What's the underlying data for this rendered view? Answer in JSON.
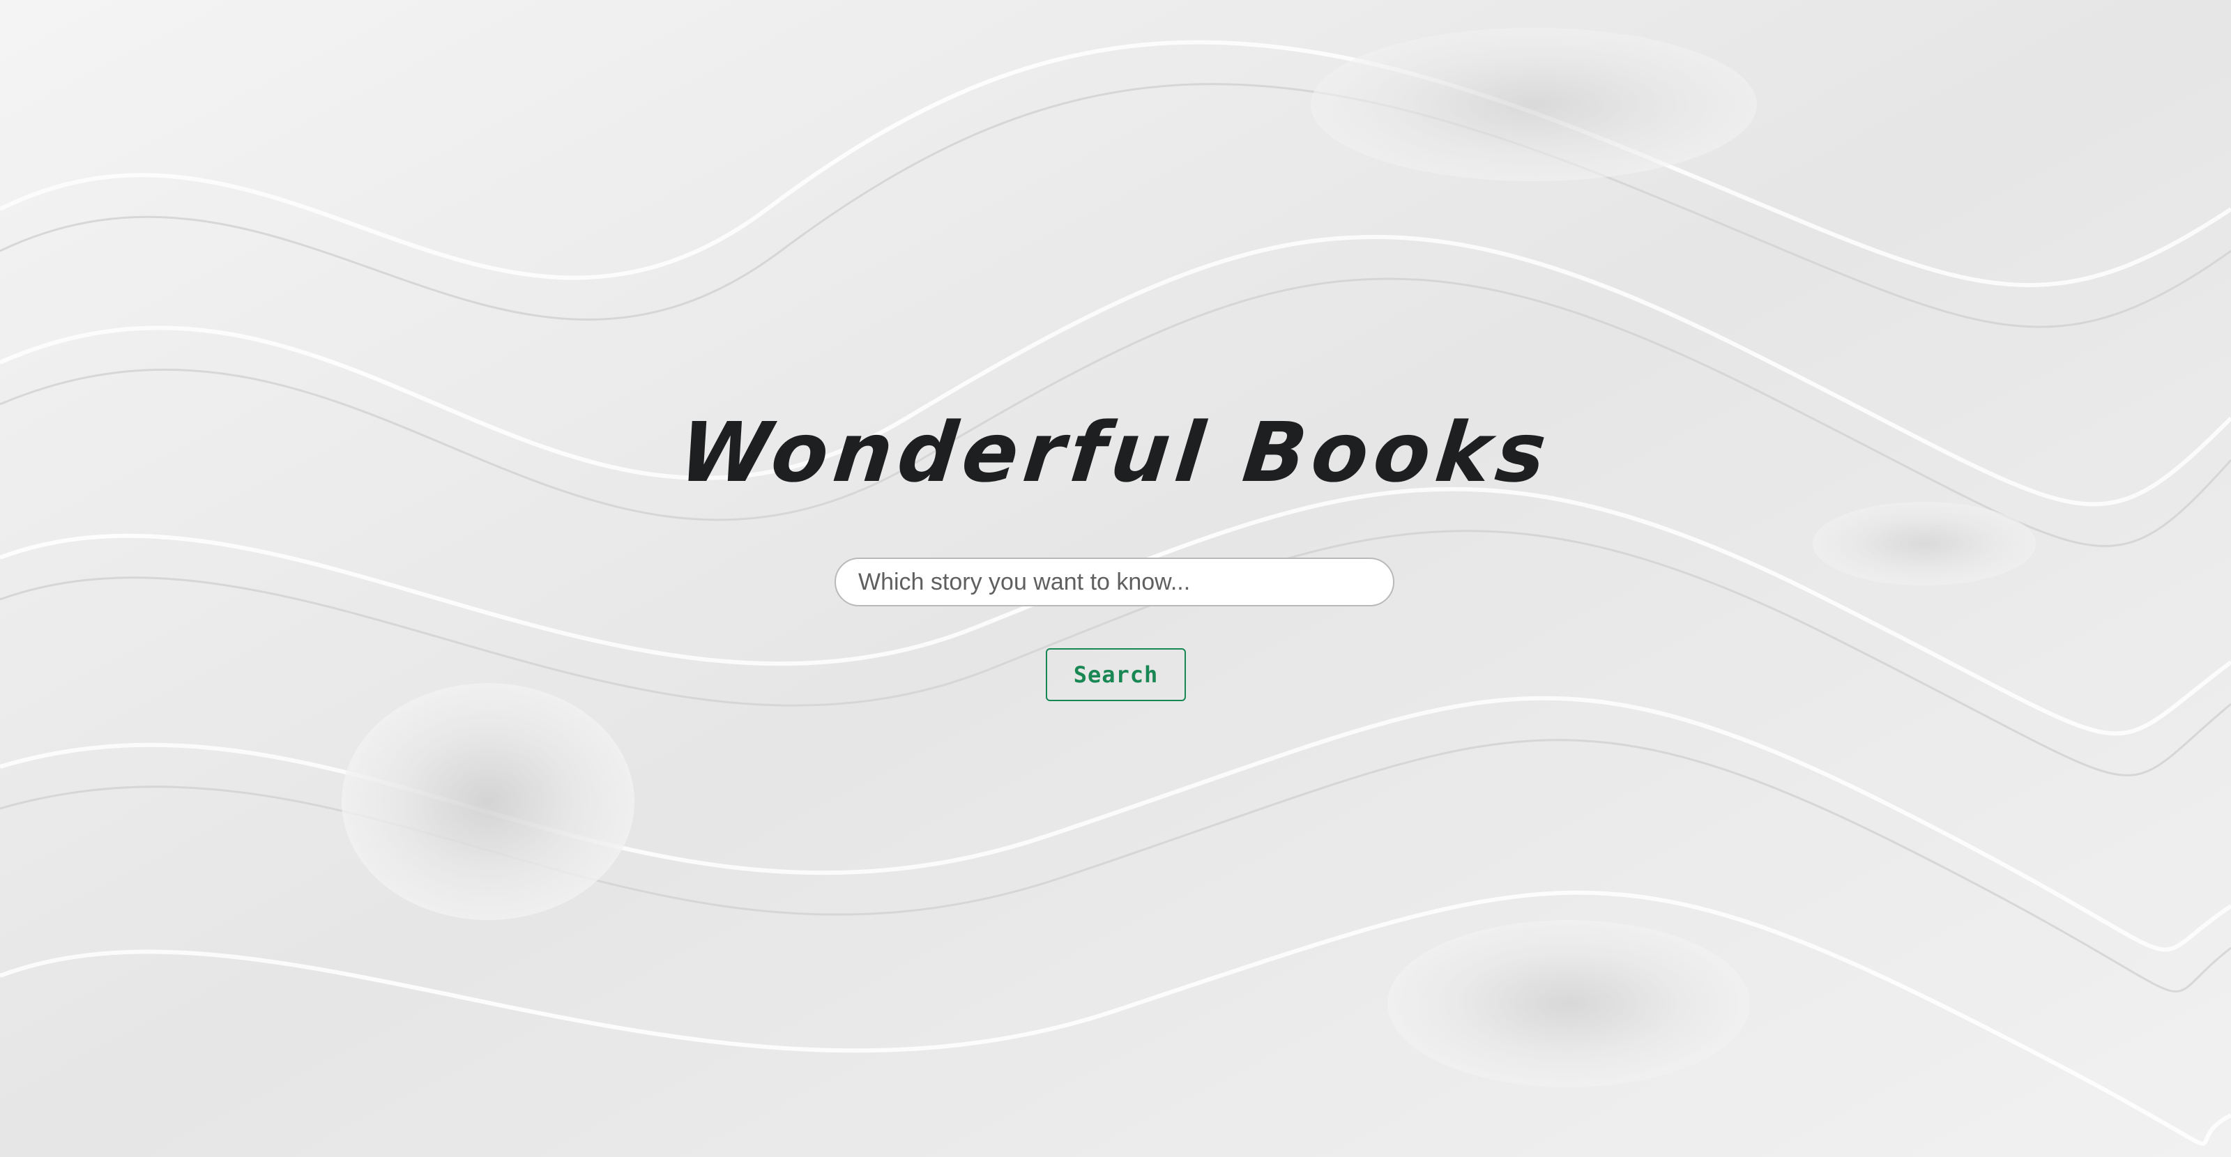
{
  "page": {
    "title": "Wonderful Books"
  },
  "search": {
    "placeholder": "Which story you want to know...",
    "value": "",
    "button_label": "Search"
  },
  "colors": {
    "title_text": "#1d1f21",
    "button_accent": "#198754",
    "background": "#e9e9e9"
  }
}
